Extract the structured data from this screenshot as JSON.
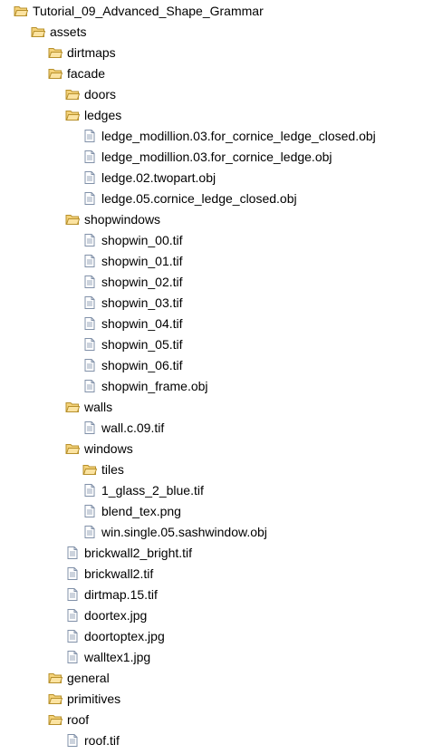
{
  "tree": [
    {
      "label": "Tutorial_09_Advanced_Shape_Grammar",
      "type": "folder",
      "depth": 0,
      "open": true
    },
    {
      "label": "assets",
      "type": "folder",
      "depth": 1,
      "open": true
    },
    {
      "label": "dirtmaps",
      "type": "folder",
      "depth": 2,
      "open": true
    },
    {
      "label": "facade",
      "type": "folder",
      "depth": 2,
      "open": true
    },
    {
      "label": "doors",
      "type": "folder",
      "depth": 3,
      "open": true
    },
    {
      "label": "ledges",
      "type": "folder",
      "depth": 3,
      "open": true
    },
    {
      "label": "ledge_modillion.03.for_cornice_ledge_closed.obj",
      "type": "file",
      "depth": 4
    },
    {
      "label": "ledge_modillion.03.for_cornice_ledge.obj",
      "type": "file",
      "depth": 4
    },
    {
      "label": "ledge.02.twopart.obj",
      "type": "file",
      "depth": 4
    },
    {
      "label": "ledge.05.cornice_ledge_closed.obj",
      "type": "file",
      "depth": 4
    },
    {
      "label": "shopwindows",
      "type": "folder",
      "depth": 3,
      "open": true
    },
    {
      "label": "shopwin_00.tif",
      "type": "file",
      "depth": 4
    },
    {
      "label": "shopwin_01.tif",
      "type": "file",
      "depth": 4
    },
    {
      "label": "shopwin_02.tif",
      "type": "file",
      "depth": 4
    },
    {
      "label": "shopwin_03.tif",
      "type": "file",
      "depth": 4
    },
    {
      "label": "shopwin_04.tif",
      "type": "file",
      "depth": 4
    },
    {
      "label": "shopwin_05.tif",
      "type": "file",
      "depth": 4
    },
    {
      "label": "shopwin_06.tif",
      "type": "file",
      "depth": 4
    },
    {
      "label": "shopwin_frame.obj",
      "type": "file",
      "depth": 4
    },
    {
      "label": "walls",
      "type": "folder",
      "depth": 3,
      "open": true
    },
    {
      "label": "wall.c.09.tif",
      "type": "file",
      "depth": 4
    },
    {
      "label": "windows",
      "type": "folder",
      "depth": 3,
      "open": true
    },
    {
      "label": "tiles",
      "type": "folder",
      "depth": 4,
      "open": true
    },
    {
      "label": "1_glass_2_blue.tif",
      "type": "file",
      "depth": 4
    },
    {
      "label": "blend_tex.png",
      "type": "file",
      "depth": 4
    },
    {
      "label": "win.single.05.sashwindow.obj",
      "type": "file",
      "depth": 4
    },
    {
      "label": "brickwall2_bright.tif",
      "type": "file",
      "depth": 3
    },
    {
      "label": "brickwall2.tif",
      "type": "file",
      "depth": 3
    },
    {
      "label": "dirtmap.15.tif",
      "type": "file",
      "depth": 3
    },
    {
      "label": "doortex.jpg",
      "type": "file",
      "depth": 3
    },
    {
      "label": "doortoptex.jpg",
      "type": "file",
      "depth": 3
    },
    {
      "label": "walltex1.jpg",
      "type": "file",
      "depth": 3
    },
    {
      "label": "general",
      "type": "folder",
      "depth": 2,
      "open": true
    },
    {
      "label": "primitives",
      "type": "folder",
      "depth": 2,
      "open": true
    },
    {
      "label": "roof",
      "type": "folder",
      "depth": 2,
      "open": true
    },
    {
      "label": "roof.tif",
      "type": "file",
      "depth": 3
    }
  ],
  "colors": {
    "folder_fill": "#f4d27a",
    "folder_stroke": "#b7902b",
    "folder_front": "#fbe3a1",
    "file_stroke": "#8090a8",
    "file_lines": "#9aa7bb"
  }
}
